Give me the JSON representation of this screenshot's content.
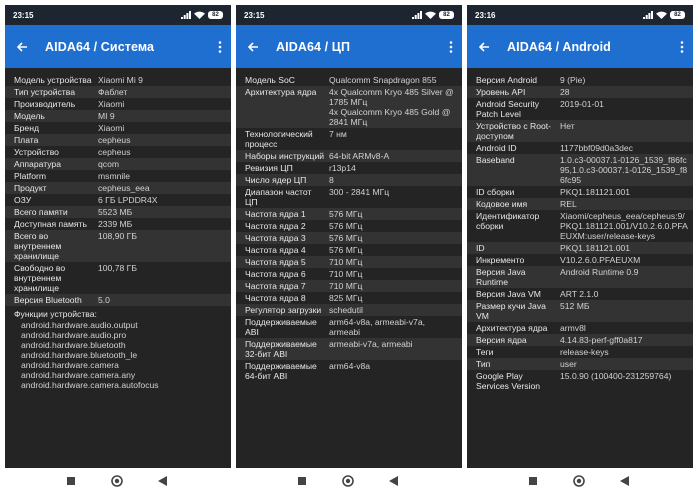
{
  "colors": {
    "appbar": "#1f6fd1",
    "statusbar": "#1c2530",
    "background": "#242424",
    "row_alt": "#333333",
    "text": "#e8e8e8"
  },
  "icons": {
    "back": "back-arrow-icon",
    "menu": "more-vert-icon",
    "signal": "signal-icon",
    "wifi": "wifi-icon",
    "battery": "battery-icon",
    "nav_recents": "square-icon",
    "nav_home": "circle-icon",
    "nav_back": "triangle-icon"
  },
  "screens": [
    {
      "time": "23:15",
      "battery": "82",
      "title": "AIDA64 / Система",
      "rows": [
        {
          "k": "Модель устройства",
          "v": "Xiaomi Mi 9"
        },
        {
          "k": "Тип устройства",
          "v": "Фаблет"
        },
        {
          "k": "Производитель",
          "v": "Xiaomi"
        },
        {
          "k": "Модель",
          "v": "MI 9"
        },
        {
          "k": "Бренд",
          "v": "Xiaomi"
        },
        {
          "k": "Плата",
          "v": "cepheus"
        },
        {
          "k": "Устройство",
          "v": "cepheus"
        },
        {
          "k": "Аппаратура",
          "v": "qcom"
        },
        {
          "k": "Platform",
          "v": "msmnile"
        },
        {
          "k": "Продукт",
          "v": "cepheus_eea"
        },
        {
          "k": "ОЗУ",
          "v": "6 ГБ LPDDR4X"
        },
        {
          "k": "Всего памяти",
          "v": "5523 МБ"
        },
        {
          "k": "Доступная память",
          "v": "2339 МБ"
        },
        {
          "k": "Всего во внутреннем хранилище",
          "v": "108,90 ГБ"
        },
        {
          "k": "Свободно во внутреннем хранилище",
          "v": "100,78 ГБ"
        },
        {
          "k": "Версия Bluetooth",
          "v": "5.0"
        }
      ],
      "features_header": "Функции устройства:",
      "features": [
        "android.hardware.audio.output",
        "android.hardware.audio.pro",
        "android.hardware.bluetooth",
        "android.hardware.bluetooth_le",
        "android.hardware.camera",
        "android.hardware.camera.any",
        "android.hardware.camera.autofocus"
      ]
    },
    {
      "time": "23:15",
      "battery": "82",
      "title": "AIDA64 / ЦП",
      "rows": [
        {
          "k": "Модель SoC",
          "v": "Qualcomm Snapdragon 855"
        },
        {
          "k": "Архитектура ядра",
          "v": "4x Qualcomm Kryo 485 Silver @ 1785 МГц\n4x Qualcomm Kryo 485 Gold @ 2841 МГц"
        },
        {
          "k": "Технологический процесс",
          "v": "7 нм"
        },
        {
          "k": "Наборы инструкций",
          "v": "64-bit ARMv8-A"
        },
        {
          "k": "Ревизия ЦП",
          "v": "r13p14"
        },
        {
          "k": "Число ядер ЦП",
          "v": "8"
        },
        {
          "k": "Диапазон частот ЦП",
          "v": "300 - 2841 МГц"
        },
        {
          "k": "Частота ядра 1",
          "v": "576 МГц"
        },
        {
          "k": "Частота ядра 2",
          "v": "576 МГц"
        },
        {
          "k": "Частота ядра 3",
          "v": "576 МГц"
        },
        {
          "k": "Частота ядра 4",
          "v": "576 МГц"
        },
        {
          "k": "Частота ядра 5",
          "v": "710 МГц"
        },
        {
          "k": "Частота ядра 6",
          "v": "710 МГц"
        },
        {
          "k": "Частота ядра 7",
          "v": "710 МГц"
        },
        {
          "k": "Частота ядра 8",
          "v": "825 МГц"
        },
        {
          "k": "Регулятор загрузки",
          "v": "schedutil"
        },
        {
          "k": "Поддерживаемые ABI",
          "v": "arm64-v8a, armeabi-v7a, armeabi"
        },
        {
          "k": "Поддерживаемые 32-бит ABI",
          "v": "armeabi-v7a, armeabi"
        },
        {
          "k": "Поддерживаемые 64-бит ABI",
          "v": "arm64-v8a"
        }
      ]
    },
    {
      "time": "23:16",
      "battery": "82",
      "title": "AIDA64 / Android",
      "rows": [
        {
          "k": "Версия Android",
          "v": "9 (Pie)"
        },
        {
          "k": "Уровень API",
          "v": "28"
        },
        {
          "k": "Android Security Patch Level",
          "v": "2019-01-01"
        },
        {
          "k": "Устройство с Root-доступом",
          "v": "Нет"
        },
        {
          "k": "Android ID",
          "v": "1177bbf09d0a3dec"
        },
        {
          "k": "Baseband",
          "v": "1.0.c3-00037.1-0126_1539_f86fc95,1.0.c3-00037.1-0126_1539_f86fc95"
        },
        {
          "k": "ID сборки",
          "v": "PKQ1.181121.001"
        },
        {
          "k": "Кодовое имя",
          "v": "REL"
        },
        {
          "k": "Идентификатор сборки",
          "v": "Xiaomi/cepheus_eea/cepheus:9/PKQ1.181121.001/V10.2.6.0.PFAEUXM:user/release-keys"
        },
        {
          "k": "ID",
          "v": "PKQ1.181121.001"
        },
        {
          "k": "Инкременто",
          "v": "V10.2.6.0.PFAEUXM"
        },
        {
          "k": "Версия Java Runtime",
          "v": "Android Runtime 0.9"
        },
        {
          "k": "Версия Java VM",
          "v": "ART 2.1.0"
        },
        {
          "k": "Размер кучи Java VM",
          "v": "512 МБ"
        },
        {
          "k": "Архитектура ядра",
          "v": "armv8l"
        },
        {
          "k": "Версия ядра",
          "v": "4.14.83-perf-gff0a817"
        },
        {
          "k": "Теги",
          "v": "release-keys"
        },
        {
          "k": "Тип",
          "v": "user"
        },
        {
          "k": "Google Play Services Version",
          "v": "15.0.90 (100400-231259764)"
        }
      ]
    }
  ]
}
